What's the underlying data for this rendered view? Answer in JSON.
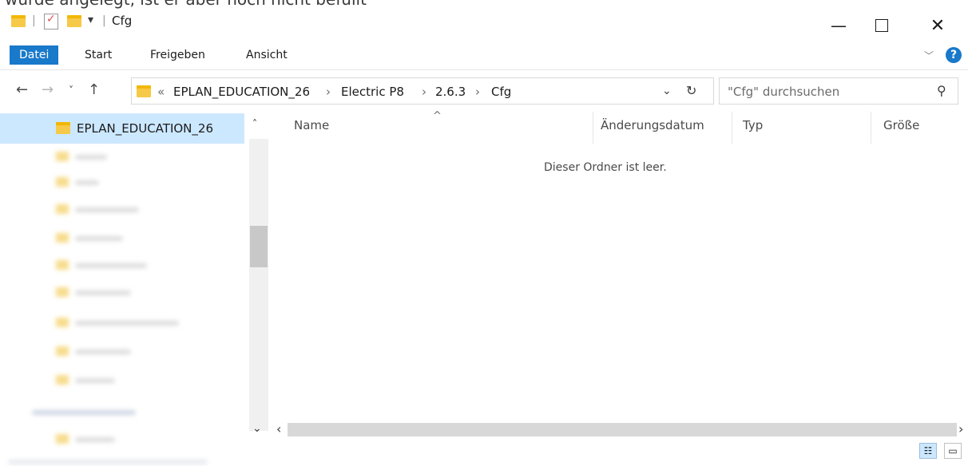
{
  "window": {
    "title": "Cfg",
    "minimize_icon": "minimize-icon",
    "maximize_icon": "maximize-icon",
    "close_icon": "close-icon"
  },
  "ribbon": {
    "tabs": [
      {
        "label": "Datei"
      },
      {
        "label": "Start"
      },
      {
        "label": "Freigeben"
      },
      {
        "label": "Ansicht"
      }
    ],
    "expand_icon": "chevron-down-icon",
    "help_label": "?"
  },
  "navigation": {
    "back_icon": "arrow-left-icon",
    "forward_icon": "arrow-right-icon",
    "recent_icon": "chevron-down-icon",
    "up_icon": "arrow-up-icon",
    "breadcrumb": {
      "overflow": "«",
      "items": [
        "EPLAN_EDUCATION_26",
        "Electric P8",
        "2.6.3",
        "Cfg"
      ],
      "separator": "›"
    },
    "dropdown_icon": "chevron-down-icon",
    "refresh_icon": "refresh-icon",
    "search": {
      "placeholder": "\"Cfg\" durchsuchen",
      "icon": "search-icon"
    }
  },
  "nav_pane": {
    "selected_item": "EPLAN_EDUCATION_26"
  },
  "file_list": {
    "columns": [
      "Name",
      "Änderungsdatum",
      "Typ",
      "Größe"
    ],
    "sort_indicator": "^",
    "empty_message": "Dieser Ordner ist leer."
  }
}
